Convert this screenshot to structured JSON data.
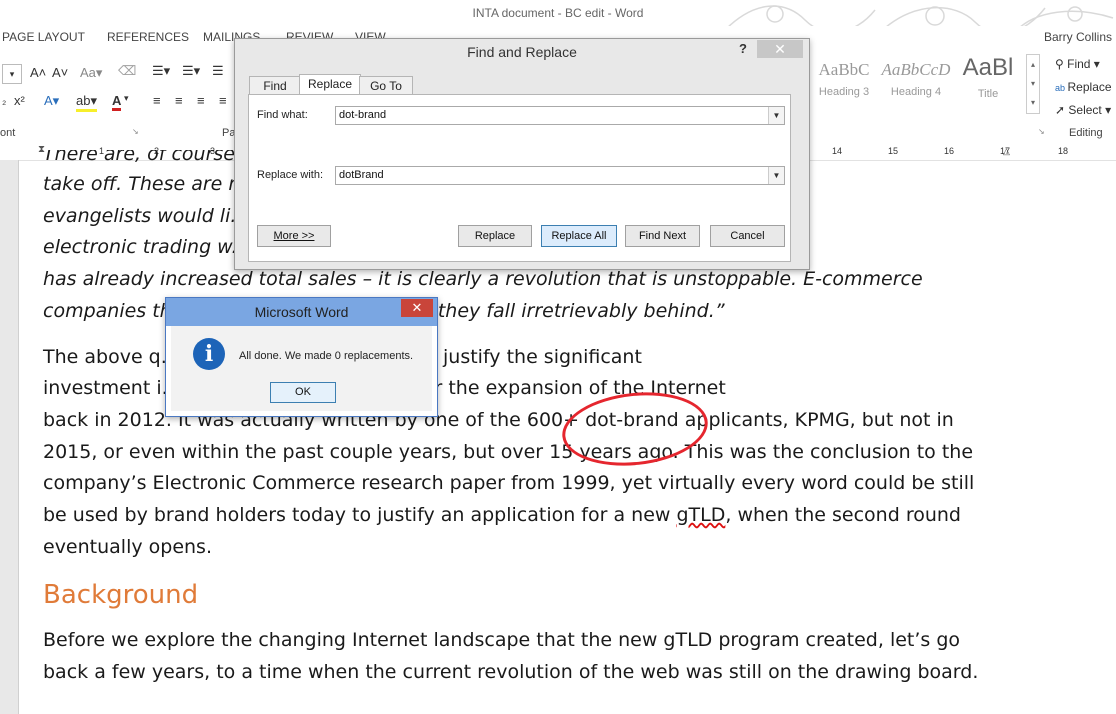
{
  "window": {
    "title": "INTA document - BC edit - Word"
  },
  "ribbon_tabs": [
    "PAGE LAYOUT",
    "REFERENCES",
    "MAILINGS",
    "REVIEW",
    "VIEW"
  ],
  "user": "Barry Collins",
  "ribbon": {
    "font_group_label": "ont",
    "paragraph_group_label": "Pa",
    "styles": [
      {
        "sample": "AaBbC",
        "name": "Heading 3"
      },
      {
        "sample": "AaBbCcD",
        "name": "Heading 4"
      },
      {
        "sample": "AaBl",
        "name": "Title"
      }
    ],
    "editing": {
      "find": "Find",
      "replace": "Replace",
      "select": "Select",
      "group_label": "Editing"
    }
  },
  "ruler": [
    "1",
    "2",
    "3",
    "14",
    "15",
    "16",
    "17",
    "18"
  ],
  "document": {
    "quote_lines": [
      "There are, of course, ... evolution can really",
      "take off. These are n... n some e-commerce",
      "evangelists would li... dents believe that",
      "electronic trading w... y that the Internet",
      "has already increased total sales – it is clearly a revolution that is unstoppable. E-commerce",
      "companies th... ve a brief window before they fall irretrievably behind.”"
    ],
    "para1_lines": [
      "The above q... ritten by a brand holder to justify the significant",
      "investment i... lication window opened for the expansion of the Internet",
      "back in 2012. It was actually written by one of the 600+ dot-brand applicants, KPMG, but not in",
      "2015, or even within the past couple years, but over 15 years ago. This was the conclusion to the",
      "company’s Electronic Commerce research paper from 1999, yet virtually every word could be still"
    ],
    "para1_last_a": "be used by brand holders today to justify an application for a new ",
    "para1_last_flag": "gTLD",
    "para1_last_b": ", when the second round",
    "para1_end": "eventually opens.",
    "heading": "Background",
    "para2_lines": [
      "Before we explore the changing Internet landscape that the new gTLD program created, let’s go",
      "back a few years, to a time when the current revolution of the web was still on the drawing board."
    ]
  },
  "find_replace": {
    "title": "Find and Replace",
    "help": "?",
    "close": "✕",
    "tabs": [
      "Find",
      "Replace",
      "Go To"
    ],
    "find_label": "Find what:",
    "find_value": "dot-brand",
    "replace_label": "Replace with:",
    "replace_value": "dotBrand",
    "buttons": {
      "more": "More >>",
      "replace": "Replace",
      "replace_all": "Replace All",
      "find_next": "Find Next",
      "cancel": "Cancel"
    }
  },
  "message_box": {
    "title": "Microsoft Word",
    "close": "✕",
    "icon": "info-icon",
    "text": "All done. We made 0 replacements.",
    "ok": "OK"
  }
}
